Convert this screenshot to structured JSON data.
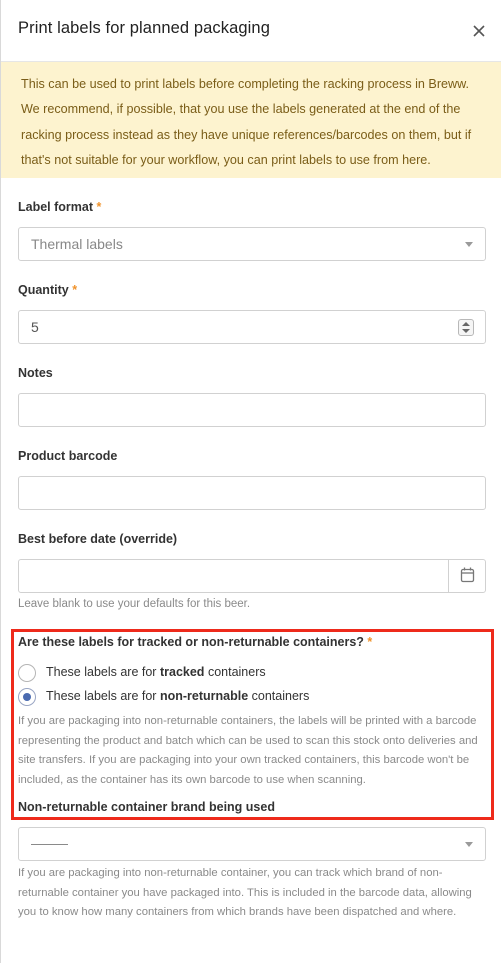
{
  "dialog": {
    "title": "Print labels for planned packaging",
    "notice": "This can be used to print labels before completing the racking process in Breww. We recommend, if possible, that you use the labels generated at the end of the racking process instead as they have unique references/barcodes on them, but if that's not suitable for your workflow, you can print labels to use from here."
  },
  "form": {
    "label_format": {
      "label": "Label format",
      "required_mark": "*",
      "value": "Thermal labels"
    },
    "quantity": {
      "label": "Quantity",
      "required_mark": "*",
      "value": "5"
    },
    "notes": {
      "label": "Notes",
      "value": ""
    },
    "product_barcode": {
      "label": "Product barcode",
      "value": ""
    },
    "best_before": {
      "label": "Best before date (override)",
      "value": "",
      "help": "Leave blank to use your defaults for this beer."
    },
    "container_type": {
      "label": "Are these labels for tracked or non-returnable containers?",
      "required_mark": "*",
      "options": [
        {
          "prefix": "These labels are for",
          "bold": "tracked",
          "suffix": "containers",
          "checked": false
        },
        {
          "prefix": "These labels are for",
          "bold": "non-returnable",
          "suffix": "containers",
          "checked": true
        }
      ],
      "help": "If you are packaging into non-returnable containers, the labels will be printed with a barcode representing the product and batch which can be used to scan this stock onto deliveries and site transfers. If you are packaging into your own tracked containers, this barcode won't be included, as the container has its own barcode to use when scanning."
    },
    "brand": {
      "label": "Non-returnable container brand being used",
      "value": "",
      "help": "If you are packaging into non-returnable container, you can track which brand of non-returnable container you have packaged into. This is included in the barcode data, allowing you to know how many containers from which brands have been dispatched and where."
    }
  },
  "colors": {
    "highlight": "#ee2a1b",
    "notice_bg": "#fdf3cf",
    "required": "#f0922a",
    "radio_selected": "#4a6ab0"
  },
  "icons": {
    "close": "close-icon",
    "calendar": "calendar-icon",
    "dropdown": "chevron-down-icon"
  }
}
